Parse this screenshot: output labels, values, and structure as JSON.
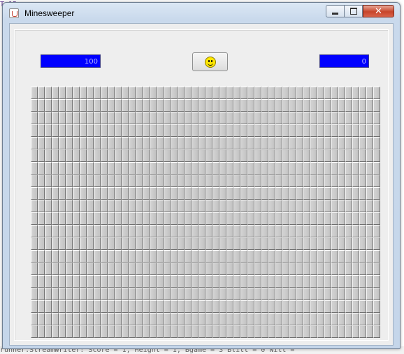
{
  "window": {
    "title": "Minesweeper",
    "controls": {
      "minimize": "minimize",
      "maximize": "maximize",
      "close": "✕"
    }
  },
  "header": {
    "mine_counter": "100",
    "timer": "0",
    "reset_icon": "smiley-face-icon"
  },
  "board": {
    "rows": 20,
    "cols": 50
  },
  "background_text": {
    "bottom_line": "runner.StreamWriter: Score = 1, Height = 1, Bgame = 3 Blitt = 0 Nitt ="
  },
  "colors": {
    "counter_bg": "#0000ff",
    "counter_text": "#b8b8ff",
    "cell": "#c8c8c8",
    "smiley": "#ffe600"
  }
}
